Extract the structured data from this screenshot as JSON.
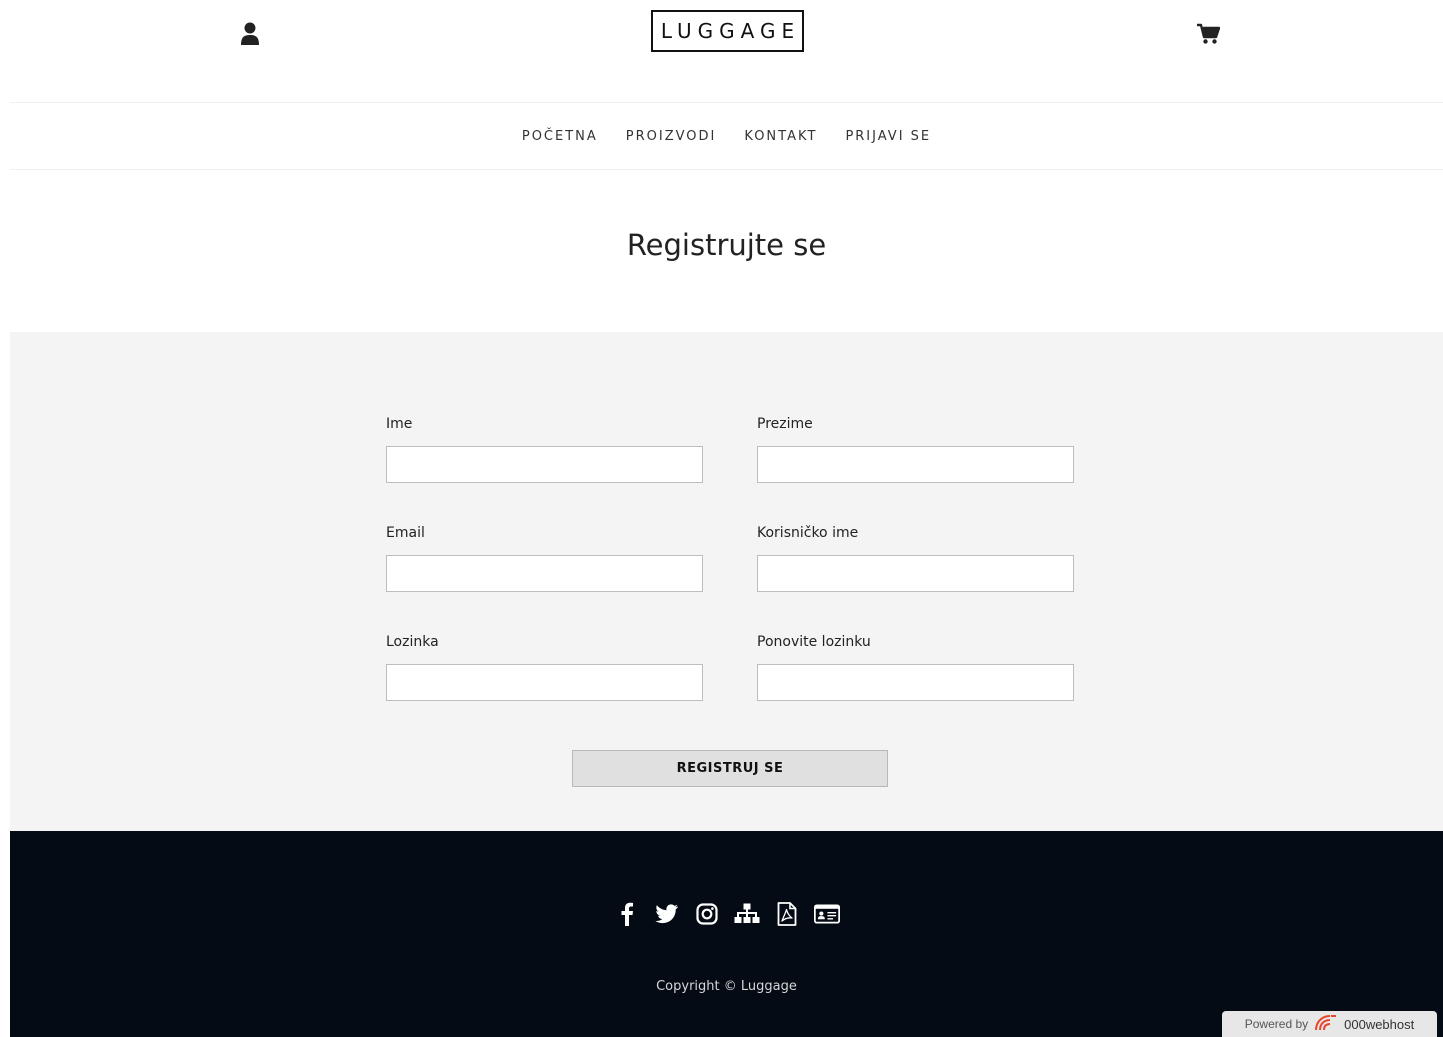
{
  "header": {
    "logo": "LUGGAGE",
    "user_icon": "user-icon",
    "cart_icon": "shopping-cart-icon"
  },
  "nav": {
    "items": [
      "POČETNA",
      "PROIZVODI",
      "KONTAKT",
      "PRIJAVI SE"
    ]
  },
  "page_title": "Registrujte se",
  "form": {
    "first_name_label": "Ime",
    "first_name_value": "",
    "last_name_label": "Prezime",
    "last_name_value": "",
    "email_label": "Email",
    "email_value": "",
    "username_label": "Korisničko ime",
    "username_value": "",
    "password_label": "Lozinka",
    "password_value": "",
    "repeat_password_label": "Ponovite lozinku",
    "repeat_password_value": "",
    "submit_label": "REGISTRUJ SE"
  },
  "footer": {
    "social_icons": [
      "facebook-icon",
      "twitter-icon",
      "instagram-icon",
      "sitemap-icon",
      "pdf-file-icon",
      "id-card-icon"
    ],
    "copyright": "Copyright © Luggage",
    "powered_by": "Powered by",
    "powered_brand": "000webhost"
  },
  "colors": {
    "footer_bg": "#050b14",
    "form_band_bg": "#f4f4f4",
    "button_bg": "#e0e0e0",
    "powered_accent": "#e8462f"
  }
}
